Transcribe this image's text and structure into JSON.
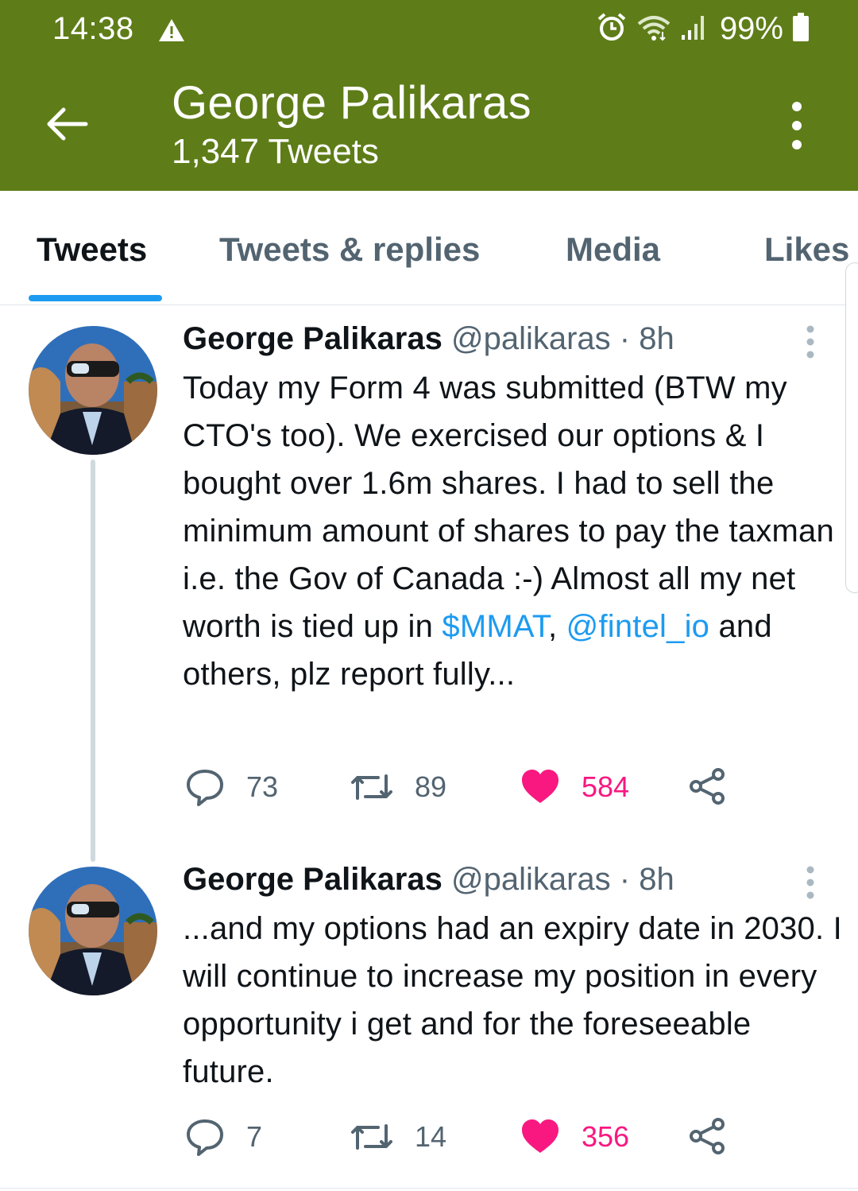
{
  "theme": {
    "accent": "#5e7d18",
    "link": "#1d9bf0",
    "like": "#f91880"
  },
  "status_bar": {
    "time": "14:38",
    "battery": "99%",
    "icons": [
      "alert-triangle-icon",
      "alarm-icon",
      "wifi-icon",
      "signal-icon",
      "battery-icon"
    ]
  },
  "header": {
    "title": "George Palikaras",
    "subtitle": "1,347 Tweets"
  },
  "tabs": [
    {
      "label": "Tweets",
      "active": true
    },
    {
      "label": "Tweets & replies",
      "active": false
    },
    {
      "label": "Media",
      "active": false
    },
    {
      "label": "Likes",
      "active": false
    }
  ],
  "tweets": [
    {
      "name": "George Palikaras",
      "meta": "@palikaras · 8h",
      "text_before": "Today my Form 4 was submitted (BTW my CTO's too). We exercised our options & I bought over 1.6m shares. I had to sell the minimum amount of shares to pay the taxman i.e. the Gov of Canada :-) Almost all my net worth is tied up in ",
      "cashtag": "$MMAT",
      "separator": ", ",
      "mention": "@fintel_io",
      "text_after": " and others, plz report fully...",
      "replies": "73",
      "retweets": "89",
      "likes": "584",
      "liked": true
    },
    {
      "name": "George Palikaras",
      "meta": "@palikaras · 8h",
      "text": "...and my options had an expiry date in 2030. I will continue to increase my position in every opportunity i get and for the foreseeable future.",
      "replies": "7",
      "retweets": "14",
      "likes": "356",
      "liked": true
    }
  ]
}
